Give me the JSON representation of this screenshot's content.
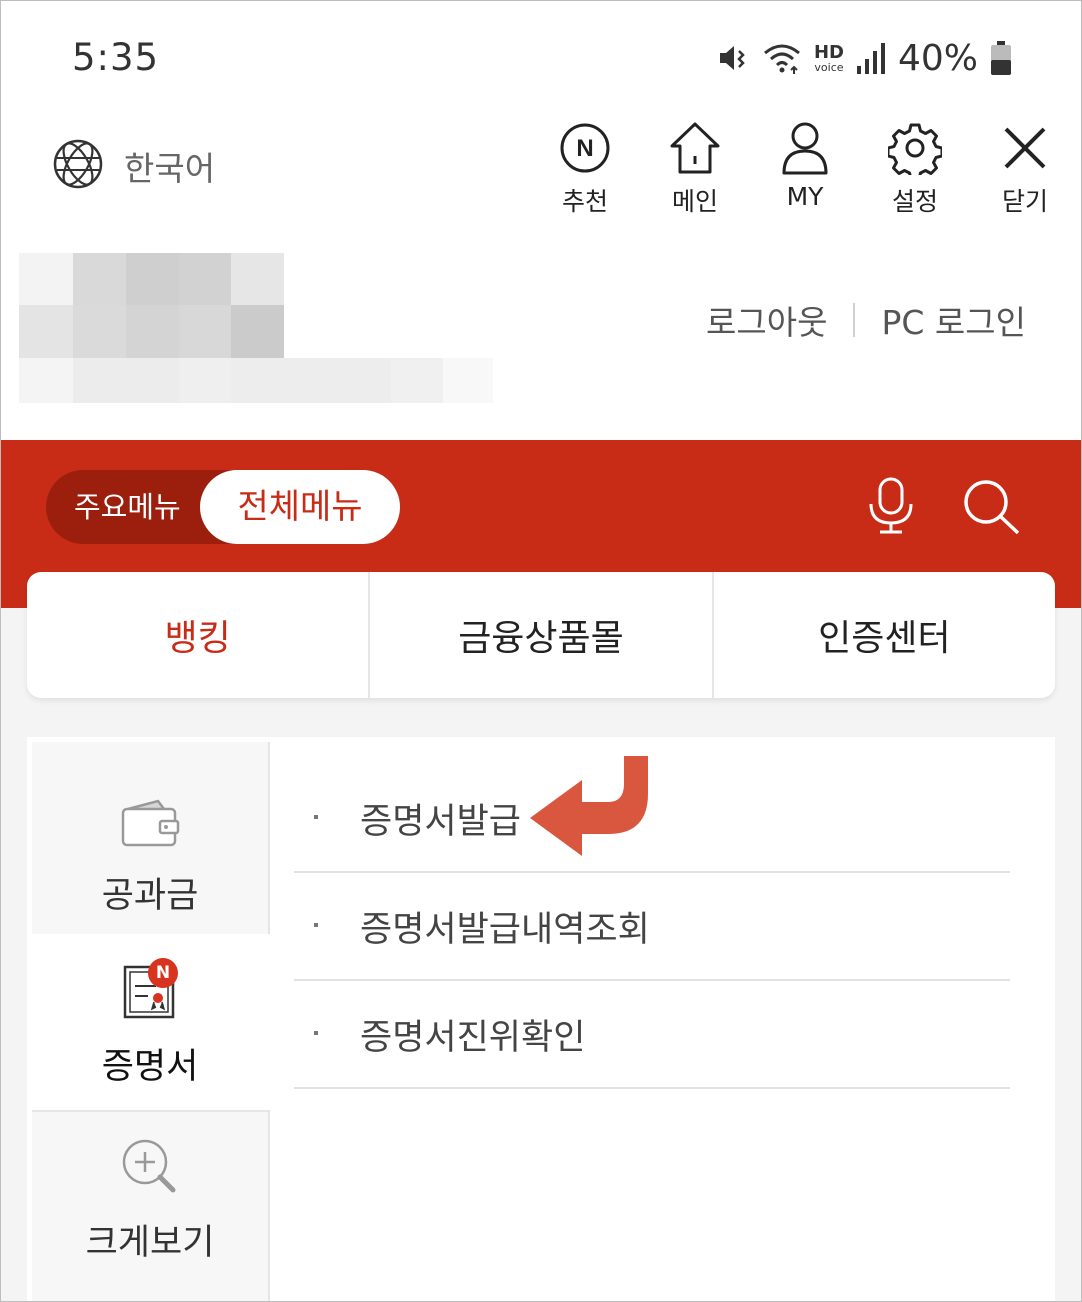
{
  "status_bar": {
    "time": "5:35",
    "hd_label": "HD",
    "voice_label": "voice",
    "battery": "40%",
    "icons": [
      "mute-icon",
      "wifi-icon",
      "signal-icon",
      "battery-icon"
    ]
  },
  "top_nav": {
    "language_label": "한국어",
    "items": [
      {
        "label": "추천",
        "icon": "recommend-n-icon",
        "badge_letter": "N"
      },
      {
        "label": "메인",
        "icon": "home-icon"
      },
      {
        "label": "MY",
        "icon": "person-icon"
      },
      {
        "label": "설정",
        "icon": "gear-icon"
      },
      {
        "label": "닫기",
        "icon": "close-icon"
      }
    ]
  },
  "user_area": {
    "logout_label": "로그아웃",
    "pc_login_label": "PC 로그인"
  },
  "menu_toggle": {
    "main_menu_label": "주요메뉴",
    "all_menu_label": "전체메뉴",
    "selected": "전체메뉴"
  },
  "category_tabs": [
    {
      "label": "뱅킹",
      "active": true
    },
    {
      "label": "금융상품몰",
      "active": false
    },
    {
      "label": "인증센터",
      "active": false
    }
  ],
  "side_menu": [
    {
      "label": "공과금",
      "icon": "wallet-icon",
      "active": false
    },
    {
      "label": "증명서",
      "icon": "certificate-icon",
      "active": true,
      "badge": "N"
    },
    {
      "label": "크게보기",
      "icon": "zoom-in-icon",
      "active": false
    }
  ],
  "sub_menu": [
    {
      "label": "증명서발급"
    },
    {
      "label": "증명서발급내역조회"
    },
    {
      "label": "증명서진위확인"
    }
  ],
  "colors": {
    "brand_red": "#c92c16",
    "toggle_dark": "#9c1f0e",
    "annotation_arrow": "#d9573f"
  }
}
